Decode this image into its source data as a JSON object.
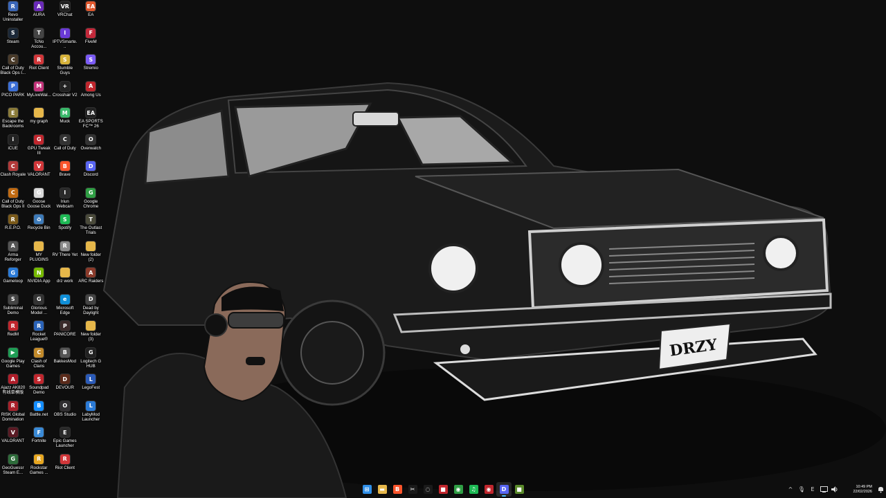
{
  "desktop": {
    "icons": [
      {
        "label": "Revo Uninstaller",
        "glyph": "R",
        "color": "#3a66b8"
      },
      {
        "label": "Steam",
        "glyph": "S",
        "color": "#1b2838"
      },
      {
        "label": "Call of Duty Black Ops I...",
        "glyph": "C",
        "color": "#4a3b2a"
      },
      {
        "label": "PICO PARK",
        "glyph": "P",
        "color": "#3c6fd6"
      },
      {
        "label": "Escape the Backrooms",
        "glyph": "E",
        "color": "#8a7b3a"
      },
      {
        "label": "iCUE",
        "glyph": "i",
        "color": "#222222"
      },
      {
        "label": "Clash Royale",
        "glyph": "C",
        "color": "#b23a3a"
      },
      {
        "label": "Call of Duty Black Ops II",
        "glyph": "C",
        "color": "#c06a12"
      },
      {
        "label": "R.E.P.O.",
        "glyph": "R",
        "color": "#7a5a1a"
      },
      {
        "label": "Arma Reforger",
        "glyph": "A",
        "color": "#555555"
      },
      {
        "label": "Gameloop",
        "glyph": "G",
        "color": "#2a7ad6"
      },
      {
        "label": "Subliminal Demo",
        "glyph": "S",
        "color": "#444444"
      },
      {
        "label": "RedM",
        "glyph": "R",
        "color": "#c0262d"
      },
      {
        "label": "Google Play Games",
        "glyph": "▶",
        "color": "#1f9d55"
      },
      {
        "label": "Ajazz AK820 有线单模版",
        "glyph": "A",
        "color": "#b01e2a"
      },
      {
        "label": "RISK Global Domination",
        "glyph": "R",
        "color": "#a8202a"
      },
      {
        "label": "VALORANT",
        "glyph": "V",
        "color": "#5a1a24"
      },
      {
        "label": "GeoGuessr Steam E...",
        "glyph": "G",
        "color": "#2d6c3a"
      },
      {
        "label": "AURA",
        "glyph": "A",
        "color": "#6a2ab8"
      },
      {
        "label": "TcNo Accou...",
        "glyph": "T",
        "color": "#444444"
      },
      {
        "label": "Riot Client",
        "glyph": "R",
        "color": "#d13639"
      },
      {
        "label": "MyLiveWal...",
        "glyph": "M",
        "color": "#c2337a"
      },
      {
        "label": "my graph",
        "glyph": "",
        "color": "#e6b74a"
      },
      {
        "label": "GPU Tweak III",
        "glyph": "G",
        "color": "#c0262d"
      },
      {
        "label": "VALORANT",
        "glyph": "V",
        "color": "#d13639"
      },
      {
        "label": "Goose Goose Duck",
        "glyph": "G",
        "color": "#d9d9d9"
      },
      {
        "label": "Recycle Bin",
        "glyph": "♻",
        "color": "#3d7ab8"
      },
      {
        "label": "MY PLUGINS",
        "glyph": "",
        "color": "#e6b74a"
      },
      {
        "label": "NVIDIA App",
        "glyph": "N",
        "color": "#76b900"
      },
      {
        "label": "Glorious Model ...",
        "glyph": "G",
        "color": "#333333"
      },
      {
        "label": "Rocket League®",
        "glyph": "R",
        "color": "#2a63b8"
      },
      {
        "label": "Clash of Clans",
        "glyph": "C",
        "color": "#c28a2a"
      },
      {
        "label": "Soundpad Demo",
        "glyph": "S",
        "color": "#c0262d"
      },
      {
        "label": "Battle.net",
        "glyph": "B",
        "color": "#148eff"
      },
      {
        "label": "Fortnite",
        "glyph": "F",
        "color": "#3a8ad6"
      },
      {
        "label": "Rockstar Games ...",
        "glyph": "R",
        "color": "#e6a620"
      },
      {
        "label": "VRChat",
        "glyph": "VR",
        "color": "#222222"
      },
      {
        "label": "IPTVSmarte...",
        "glyph": "I",
        "color": "#6a3ad6"
      },
      {
        "label": "Stumble Guys",
        "glyph": "S",
        "color": "#d6b23a"
      },
      {
        "label": "Crosshair V2",
        "glyph": "+",
        "color": "#222222"
      },
      {
        "label": "Muck",
        "glyph": "M",
        "color": "#3ab86a"
      },
      {
        "label": "Call of Duty",
        "glyph": "C",
        "color": "#333333"
      },
      {
        "label": "Brave",
        "glyph": "B",
        "color": "#fb542b"
      },
      {
        "label": "Iriun Webcam",
        "glyph": "I",
        "color": "#2a2a2a"
      },
      {
        "label": "Spotify",
        "glyph": "S",
        "color": "#1db954"
      },
      {
        "label": "RV There Yet",
        "glyph": "R",
        "color": "#8a8a8a"
      },
      {
        "label": "drz work",
        "glyph": "",
        "color": "#e6b74a"
      },
      {
        "label": "Microsoft Edge",
        "glyph": "e",
        "color": "#0f8fd8"
      },
      {
        "label": "PANICORE",
        "glyph": "P",
        "color": "#3a2a2a"
      },
      {
        "label": "BakkesMod",
        "glyph": "B",
        "color": "#555555"
      },
      {
        "label": "DEVOUR",
        "glyph": "D",
        "color": "#5a2a1a"
      },
      {
        "label": "OBS Studio",
        "glyph": "O",
        "color": "#302e31"
      },
      {
        "label": "Epic Games Launcher",
        "glyph": "E",
        "color": "#2a2a2a"
      },
      {
        "label": "Riot Client",
        "glyph": "R",
        "color": "#d13639"
      },
      {
        "label": "EA",
        "glyph": "EA",
        "color": "#e0562b"
      },
      {
        "label": "FiveM",
        "glyph": "F",
        "color": "#c2283a"
      },
      {
        "label": "Stremio",
        "glyph": "S",
        "color": "#7b5bf5"
      },
      {
        "label": "Among Us",
        "glyph": "A",
        "color": "#c0262d"
      },
      {
        "label": "EA SPORTS FC™ 26",
        "glyph": "EA",
        "color": "#222222"
      },
      {
        "label": "Overwatch",
        "glyph": "O",
        "color": "#333333"
      },
      {
        "label": "Discord",
        "glyph": "D",
        "color": "#5865f2"
      },
      {
        "label": "Google Chrome",
        "glyph": "G",
        "color": "#2f9e44"
      },
      {
        "label": "The Outlast Trials",
        "glyph": "T",
        "color": "#4a4a3a"
      },
      {
        "label": "New folder (2)",
        "glyph": "",
        "color": "#e6b74a"
      },
      {
        "label": "ARC Raiders",
        "glyph": "A",
        "color": "#8a3a2a"
      },
      {
        "label": "Dead by Daylight",
        "glyph": "D",
        "color": "#444444"
      },
      {
        "label": "New folder (3)",
        "glyph": "",
        "color": "#e6b74a"
      },
      {
        "label": "Logitech G HUB",
        "glyph": "G",
        "color": "#222222"
      },
      {
        "label": "LegoFest",
        "glyph": "L",
        "color": "#2a5ab8"
      },
      {
        "label": "LabyMod Launcher",
        "glyph": "L",
        "color": "#2a7ad6"
      }
    ]
  },
  "wallpaper": {
    "plate_text": "DRZY"
  },
  "taskbar": {
    "apps": [
      {
        "name": "start",
        "glyph": "⊞",
        "color": "#2f8fe8",
        "active": false
      },
      {
        "name": "file-explorer",
        "glyph": "▬",
        "color": "#e6b74a",
        "active": false
      },
      {
        "name": "brave",
        "glyph": "B",
        "color": "#fb542b",
        "active": false
      },
      {
        "name": "capcut",
        "glyph": "✂",
        "color": "#1a1a1a",
        "active": false
      },
      {
        "name": "loading",
        "glyph": "◌",
        "color": "#1a1a1a",
        "active": false
      },
      {
        "name": "roblox",
        "glyph": "■",
        "color": "#c0262d",
        "active": false
      },
      {
        "name": "chrome",
        "glyph": "◉",
        "color": "#2f9e44",
        "active": false
      },
      {
        "name": "spotify",
        "glyph": "♫",
        "color": "#1db954",
        "active": false
      },
      {
        "name": "chrome-2",
        "glyph": "◉",
        "color": "#c0262d",
        "active": false
      },
      {
        "name": "discord",
        "glyph": "D",
        "color": "#5865f2",
        "active": true
      },
      {
        "name": "minecraft",
        "glyph": "■",
        "color": "#5a8a2a",
        "active": false
      }
    ],
    "tray": {
      "chevron": "^",
      "mic": "🎙",
      "lang": "E",
      "clock_time": "10:49 PM",
      "clock_date": "22/02/2026"
    }
  }
}
